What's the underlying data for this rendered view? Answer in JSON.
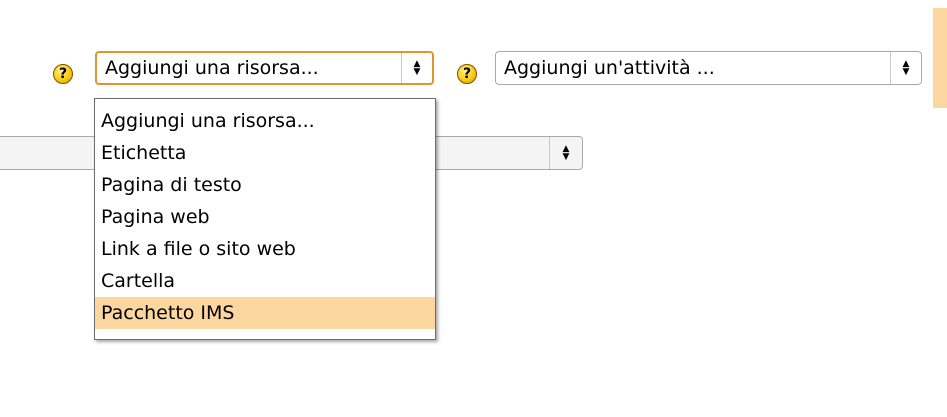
{
  "toolbar": {
    "help_icon_glyph": "?",
    "resource_select": {
      "selected": "Aggiungi una risorsa...",
      "options": [
        "Aggiungi una risorsa...",
        "Etichetta",
        "Pagina di testo",
        "Pagina web",
        "Link a file o sito web",
        "Cartella",
        "Pacchetto IMS"
      ],
      "highlighted_option": "Pacchetto IMS"
    },
    "activity_select": {
      "selected": "Aggiungi un'attività ..."
    }
  },
  "colors": {
    "highlight": "#fbd79f",
    "focus_border": "#e0962f",
    "help_icon": "#ffd21f"
  }
}
